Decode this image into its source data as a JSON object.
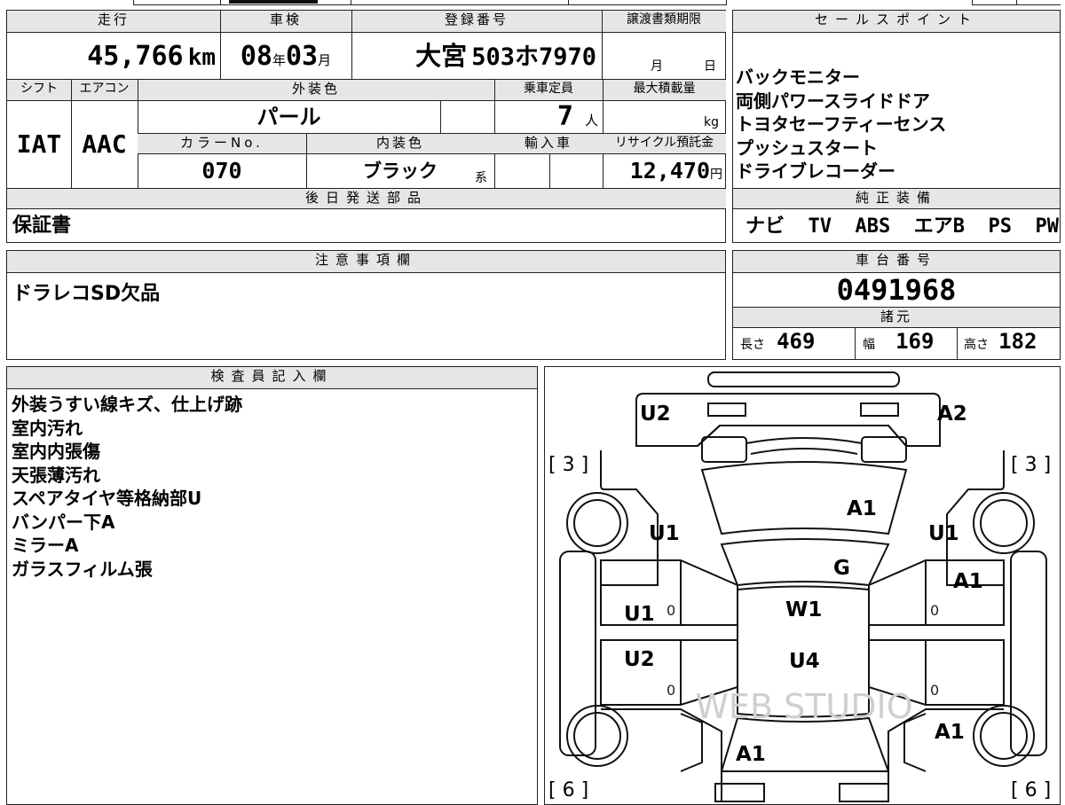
{
  "headers": {
    "mileage": "走行",
    "inspection": "車検",
    "registration": "登録番号",
    "transfer_deadline": "譲渡書類期限",
    "sales_points": "セールスポイント",
    "shift": "シフト",
    "aircon": "エアコン",
    "exterior_color": "外装色",
    "capacity": "乗車定員",
    "max_load": "最大積載量",
    "color_no": "カラーNo.",
    "interior_color": "内装色",
    "import": "輸入車",
    "recycle": "リサイクル預託金",
    "later_parts": "後日発送部品",
    "genuine_equipment": "純正装備",
    "notes": "注意事項欄",
    "chassis_no": "車台番号",
    "specs": "諸元",
    "inspector": "検査員記入欄"
  },
  "vehicle": {
    "mileage_value": "45,766",
    "mileage_unit": "km",
    "inspection_year": "08",
    "year_unit": "年",
    "inspection_month": "03",
    "month_unit": "月",
    "plate_region": "大宮",
    "plate_number": "503ホ7970",
    "deadline_month": "月",
    "deadline_day": "日",
    "shift_value": "IAT",
    "aircon_value": "AAC",
    "exterior_color_value": "パール",
    "capacity_value": "7",
    "capacity_unit": "人",
    "load_unit": "kg",
    "color_no_value": "070",
    "interior_color_value": "ブラック",
    "interior_suffix": "系",
    "recycle_value": "12,470",
    "recycle_unit": "円",
    "later_parts_value": "保証書",
    "chassis_no_value": "0491968",
    "length_label": "長さ",
    "length_value": "469",
    "width_label": "幅",
    "width_value": "169",
    "height_label": "高さ",
    "height_value": "182"
  },
  "sales_points": [
    "バックモニター",
    "両側パワースライドドア",
    "トヨタセーフティーセンス",
    "プッシュスタート",
    "ドライブレコーダー"
  ],
  "genuine_equipment_items": [
    "ナビ",
    "TV",
    "ABS",
    "エアB",
    "PS",
    "PW"
  ],
  "notes_text": "ドラレコSD欠品",
  "inspector_notes": [
    "外装うすい線キズ、仕上げ跡",
    "室内汚れ",
    "室内内張傷",
    "天張薄汚れ",
    "スペアタイヤ等格納部U",
    "バンパー下A",
    "ミラーA",
    "ガラスフィルム張"
  ],
  "diagram_labels": {
    "front_left": "U2",
    "front_right": "A2",
    "tire_front_left": "[ 3 ]",
    "tire_front_right": "[ 3 ]",
    "hood": "A1",
    "front_left_fender": "U1",
    "front_right_fender": "U1",
    "windshield": "G",
    "front_right_door": "A1",
    "roof": "W1",
    "front_left_door": "U1",
    "rear_left_door": "U2",
    "rear_roof": "U4",
    "rear_right_fender": "A1",
    "rear": "A1",
    "tire_rear_left": "[ 6 ]",
    "tire_rear_right": "[ 6 ]",
    "zero_marks": [
      "0",
      "0",
      "0",
      "0"
    ],
    "watermark": "WEB STUDIO"
  }
}
